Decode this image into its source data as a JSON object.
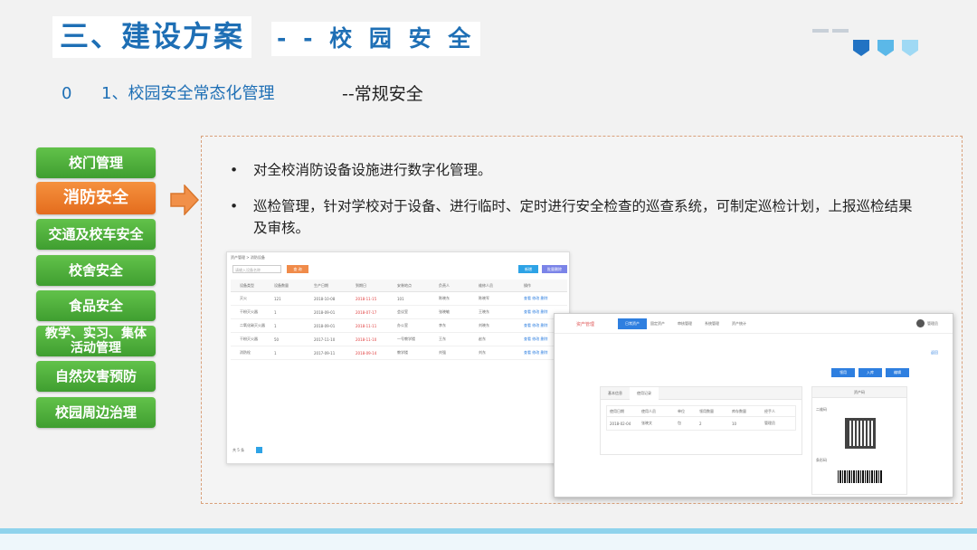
{
  "title": {
    "main": "三、建设方案",
    "sub": "- - 校 园 安 全"
  },
  "subheading": {
    "marker": "0",
    "section": "1、校园安全常态化管理",
    "category": "--常规安全"
  },
  "decor_colors": [
    "#2273c3",
    "#5bb8e8",
    "#9fd9f4"
  ],
  "nav": [
    {
      "label": "校门管理",
      "active": false
    },
    {
      "label": "消防安全",
      "active": true
    },
    {
      "label": "交通及校车安全",
      "active": false
    },
    {
      "label": "校舍安全",
      "active": false
    },
    {
      "label": "食品安全",
      "active": false
    },
    {
      "label": "教学、实习、集体活动管理",
      "active": false
    },
    {
      "label": "自然灾害预防",
      "active": false
    },
    {
      "label": "校园周边治理",
      "active": false
    }
  ],
  "bullets": [
    {
      "symbol": "•",
      "text": "对全校消防设备设施进行数字化管理。"
    },
    {
      "symbol": "•",
      "text": "巡检管理，针对学校对于设备、进行临时、定时进行安全检查的巡查系统，可制定巡检计划，上报巡检结果及审核。"
    }
  ],
  "screenshot1": {
    "breadcrumb": "资产管理 > 消防设备",
    "search_placeholder": "请输入设备名称",
    "search_button": "查 询",
    "add_button": "新增",
    "export_button": "批量删除",
    "headers": [
      "设备类型",
      "设备数量",
      "生产日期",
      "到期日",
      "安装地点",
      "负责人",
      "维修人员",
      "操作"
    ],
    "rows": [
      [
        "灭火",
        "121",
        "2018-10-08",
        "2018-11-15",
        "101",
        "陈晓东",
        "陈晓军",
        "查看 修改 删除"
      ],
      [
        "干粉灭火器",
        "1",
        "2018-09-01",
        "2018-07-17",
        "会议室",
        "张晓敏",
        "王晓东",
        "查看 修改 删除"
      ],
      [
        "二氧化碳灭火器",
        "1",
        "2018-09-01",
        "2018-11-11",
        "办公室",
        "李东",
        "刘晓东",
        "查看 修改 删除"
      ],
      [
        "干粉灭火器",
        "50",
        "2017-11-10",
        "2018-11-10",
        "一号教学楼",
        "王东",
        "赵东",
        "查看 修改 删除"
      ],
      [
        "消防栓",
        "1",
        "2017-09-11",
        "2018-09-14",
        "教学楼",
        "刘强",
        "刘东",
        "查看 修改 删除"
      ]
    ],
    "pagination": "共 5 条"
  },
  "screenshot2": {
    "logo": "资产管理",
    "tabs": [
      "日常资产",
      "固定资产",
      "审核管理",
      "系统管理",
      "资产统计"
    ],
    "user": "管理员",
    "back_link": "返回",
    "action_buttons": [
      "领用",
      "入库",
      "编辑"
    ],
    "sub_tabs": [
      "基本信息",
      "使用记录"
    ],
    "headers": [
      "使用日期",
      "使用人员",
      "单位",
      "领用数量",
      "库存数量",
      "经手人"
    ],
    "row": [
      "2018-02-04",
      "张晓文",
      "包",
      "2",
      "10",
      "管理员"
    ],
    "qr_title": "资产码",
    "qr_label": "二维码",
    "barcode_label": "条形码"
  }
}
